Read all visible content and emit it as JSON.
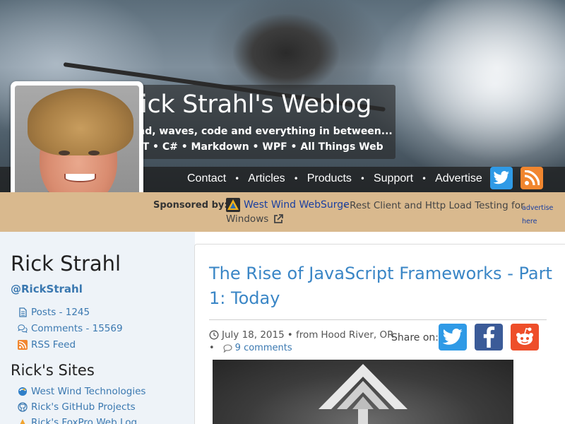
{
  "header": {
    "title": "Rick Strahl's Weblog",
    "tagline": "Wind, waves, code and everything in between...",
    "topics": ".NET • C# • Markdown • WPF • All Things Web"
  },
  "nav": {
    "items": [
      {
        "label": "Contact"
      },
      {
        "label": "Articles"
      },
      {
        "label": "Products"
      },
      {
        "label": "Support"
      },
      {
        "label": "Advertise"
      }
    ],
    "separator": "•",
    "social": [
      {
        "icon": "twitter-icon",
        "color": "#2f9ae6"
      },
      {
        "icon": "rss-icon",
        "color": "#f1862f"
      }
    ]
  },
  "sponsor": {
    "label": "Sponsored by:",
    "link_text": "West Wind WebSurge",
    "description_line1": "- Rest Client and Http Load Testing for",
    "description_line2": "Windows",
    "advertise_line1": "advertise",
    "advertise_line2": "here",
    "icon": "websurge-icon"
  },
  "sidebar": {
    "name": "Rick Strahl",
    "handle": "@RickStrahl",
    "stats": [
      {
        "icon": "document-icon",
        "label": "Posts - 1245"
      },
      {
        "icon": "comments-icon",
        "label": "Comments - 15569"
      },
      {
        "icon": "rss-icon",
        "label": "RSS Feed"
      }
    ],
    "sites_heading": "Rick's Sites",
    "sites": [
      {
        "icon": "westwind-icon",
        "label": "West Wind Technologies"
      },
      {
        "icon": "github-icon",
        "label": "Rick's GitHub Projects"
      },
      {
        "icon": "foxpro-icon",
        "label": "Rick's FoxPro Web Log"
      }
    ]
  },
  "article": {
    "title": "The Rise of JavaScript Frameworks - Part 1: Today",
    "date": "July 18, 2015",
    "location_prefix": "• from",
    "location": "Hood River, OR",
    "bullet": "•",
    "comments": "9 comments",
    "share_label": "Share on:",
    "share_buttons": [
      {
        "icon": "twitter-icon",
        "color": "#2f9ae6"
      },
      {
        "icon": "facebook-icon",
        "color": "#3b5b98"
      },
      {
        "icon": "reddit-icon",
        "color": "#ee4e2a"
      }
    ]
  },
  "colors": {
    "accent_blue": "#3a86c6",
    "link_blue": "#3a78b0",
    "sponsor_bar": "#d9b98e",
    "sidebar_bg": "#eef3f8"
  }
}
